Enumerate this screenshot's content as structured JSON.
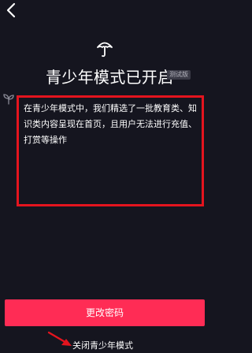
{
  "header": {
    "back_icon": "back-chevron-icon"
  },
  "hero": {
    "icon": "umbrella-shield-icon",
    "title": "青少年模式已开启",
    "badge": "测试版"
  },
  "content": {
    "leaf_icon": "leaf-icon",
    "description": "在青少年模式中，我们精选了一批教育类、知识类内容呈现在首页，且用户无法进行充值、打赏等操作",
    "highlight_color": "#e4141e"
  },
  "actions": {
    "change_password_label": "更改密码",
    "close_mode_label": "关闭青少年模式",
    "primary_color": "#ff2c55",
    "annotation_arrow_color": "#e4141e"
  }
}
